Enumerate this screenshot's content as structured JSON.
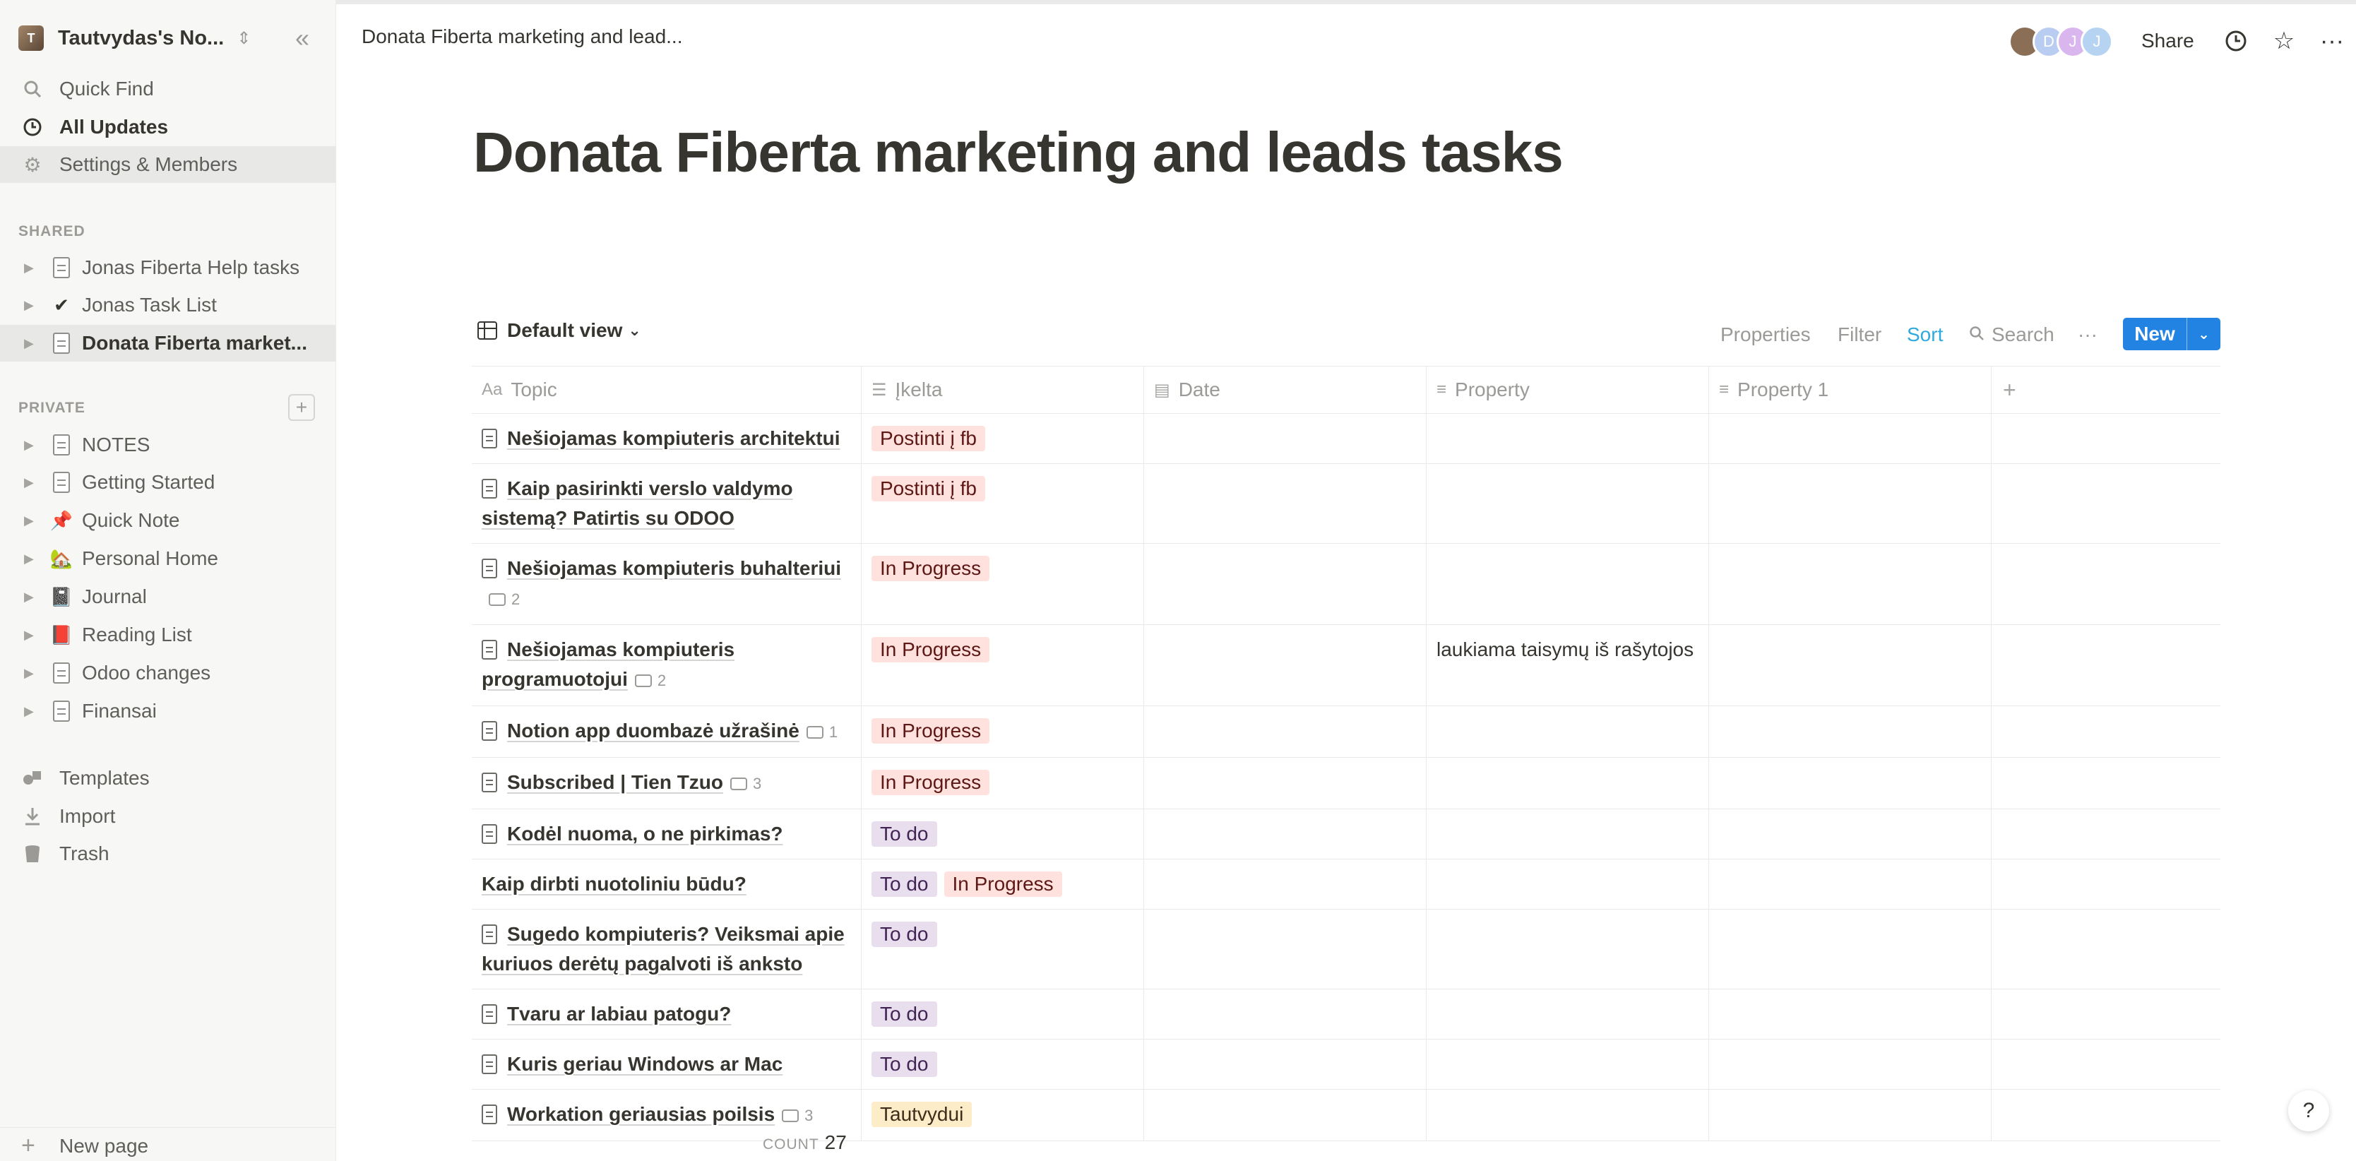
{
  "workspace": {
    "name": "Tautvydas's No...",
    "avatar_letter": "T"
  },
  "sidebar": {
    "nav": [
      {
        "label": "Quick Find",
        "icon": "search-icon"
      },
      {
        "label": "All Updates",
        "icon": "clock-icon"
      },
      {
        "label": "Settings & Members",
        "icon": "gear-icon"
      }
    ],
    "shared_header": "SHARED",
    "shared": [
      {
        "label": "Jonas Fiberta Help tasks",
        "icon": "page-icon"
      },
      {
        "label": "Jonas Task List",
        "icon": "check-icon",
        "glyph": "✔"
      },
      {
        "label": "Donata Fiberta market...",
        "icon": "page-icon"
      }
    ],
    "private_header": "PRIVATE",
    "private": [
      {
        "label": "NOTES",
        "icon": "page-icon"
      },
      {
        "label": "Getting Started",
        "icon": "page-icon"
      },
      {
        "label": "Quick Note",
        "icon": "pushpin-icon",
        "glyph": "📌"
      },
      {
        "label": "Personal Home",
        "icon": "house-icon",
        "glyph": "🏡"
      },
      {
        "label": "Journal",
        "icon": "notebook-icon",
        "glyph": "📓"
      },
      {
        "label": "Reading List",
        "icon": "book-icon",
        "glyph": "📕"
      },
      {
        "label": "Odoo changes",
        "icon": "page-icon"
      },
      {
        "label": "Finansai",
        "icon": "page-icon"
      }
    ],
    "tools": [
      {
        "label": "Templates",
        "icon": "shapes-icon"
      },
      {
        "label": "Import",
        "icon": "download-icon"
      },
      {
        "label": "Trash",
        "icon": "trash-icon"
      }
    ],
    "new_page": "New page"
  },
  "topbar": {
    "breadcrumb": "Donata Fiberta marketing and lead...",
    "avatars": [
      {
        "letter": "",
        "color": "#8a6e55"
      },
      {
        "letter": "D",
        "color": "#b9cdf2"
      },
      {
        "letter": "J",
        "color": "#d9b6ee"
      },
      {
        "letter": "J",
        "color": "#b6d4f2"
      }
    ],
    "share": "Share"
  },
  "page": {
    "title": "Donata Fiberta marketing and leads tasks"
  },
  "db": {
    "view": "Default view",
    "tools": {
      "properties": "Properties",
      "filter": "Filter",
      "sort": "Sort",
      "search": "Search",
      "new": "New"
    },
    "columns": [
      {
        "label": "Topic",
        "icon": "Aa"
      },
      {
        "label": "Įkelta",
        "icon": "☰"
      },
      {
        "label": "Date",
        "icon": "▤"
      },
      {
        "label": "Property",
        "icon": "≡"
      },
      {
        "label": "Property 1",
        "icon": "≡"
      }
    ],
    "rows": [
      {
        "topic": "Nešiojamas kompiuteris architektui",
        "doc": true,
        "comments": "",
        "tags": [
          "Postinti į fb"
        ],
        "property": ""
      },
      {
        "topic": "Kaip pasirinkti verslo valdymo sistemą? Patirtis su ODOO",
        "doc": true,
        "comments": "",
        "tags": [
          "Postinti į fb"
        ],
        "property": ""
      },
      {
        "topic": "Nešiojamas kompiuteris buhalteriui",
        "doc": true,
        "comments": "2",
        "tags": [
          "In Progress"
        ],
        "property": ""
      },
      {
        "topic": "Nešiojamas kompiuteris programuotojui",
        "doc": true,
        "comments": "2",
        "tags": [
          "In Progress"
        ],
        "property": "laukiama taisymų iš rašytojos"
      },
      {
        "topic": "Notion app duombazė užrašinė",
        "doc": true,
        "comments": "1",
        "tags": [
          "In Progress"
        ],
        "property": ""
      },
      {
        "topic": "Subscribed | Tien Tzuo",
        "doc": true,
        "comments": "3",
        "tags": [
          "In Progress"
        ],
        "property": ""
      },
      {
        "topic": "Kodėl nuoma, o ne pirkimas?",
        "doc": true,
        "comments": "",
        "tags": [
          "To do"
        ],
        "property": ""
      },
      {
        "topic": "Kaip dirbti nuotoliniu būdu?",
        "doc": false,
        "comments": "",
        "tags": [
          "To do",
          "In Progress"
        ],
        "property": ""
      },
      {
        "topic": "Sugedo kompiuteris? Veiksmai apie kuriuos derėtų pagalvoti iš anksto",
        "doc": true,
        "comments": "",
        "tags": [
          "To do"
        ],
        "property": ""
      },
      {
        "topic": "Tvaru ar labiau patogu?",
        "doc": true,
        "comments": "",
        "tags": [
          "To do"
        ],
        "property": ""
      },
      {
        "topic": "Kuris geriau Windows ar Mac",
        "doc": true,
        "comments": "",
        "tags": [
          "To do"
        ],
        "property": ""
      },
      {
        "topic": "Workation geriausias poilsis",
        "doc": true,
        "comments": "3",
        "tags": [
          "Tautvydui"
        ],
        "property": ""
      }
    ],
    "tag_colors": {
      "Postinti į fb": {
        "bg": "#ffe2dd",
        "fg": "#5d1715"
      },
      "In Progress": {
        "bg": "#ffe2dd",
        "fg": "#5d1715"
      },
      "To do": {
        "bg": "#e8deee",
        "fg": "#412454"
      },
      "Tautvydui": {
        "bg": "#fdecc8",
        "fg": "#402c1b"
      }
    },
    "count_label": "COUNT",
    "count": "27"
  },
  "help": "?"
}
